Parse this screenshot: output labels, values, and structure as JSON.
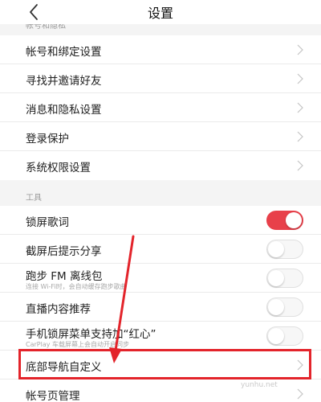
{
  "header": {
    "title": "设置",
    "back_icon": "chevron-left-icon"
  },
  "section_account": {
    "label": "帐号和隐私"
  },
  "account_rows": [
    {
      "title": "帐号和绑定设置"
    },
    {
      "title": "寻找并邀请好友"
    },
    {
      "title": "消息和隐私设置"
    },
    {
      "title": "登录保护"
    },
    {
      "title": "系统权限设置"
    }
  ],
  "section_tools": {
    "label": "工具"
  },
  "tool_rows": [
    {
      "title": "锁屏歌词",
      "toggle": true
    },
    {
      "title": "截屏后提示分享",
      "toggle": false
    },
    {
      "title": "跑步 FM 离线包",
      "subtitle": "连接 Wi-Fi时，会自动缓存跑步歌曲",
      "toggle": false
    },
    {
      "title": "直播内容推荐",
      "toggle": false
    },
    {
      "title": "手机锁屏菜单支持加“红心”",
      "subtitle": "CarPlay 车载屏幕上会自动开启同步",
      "toggle": false
    },
    {
      "title": "底部导航自定义"
    },
    {
      "title": "帐号页管理"
    }
  ],
  "colors": {
    "accent": "#e8404a",
    "annotation": "#e3242b"
  },
  "watermark": "yunhu.net"
}
